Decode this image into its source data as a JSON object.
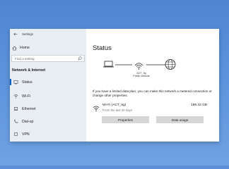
{
  "window": {
    "title": "Settings"
  },
  "sidebar": {
    "home_label": "Home",
    "search_placeholder": "Find a setting",
    "section_title": "Network & Internet",
    "items": [
      {
        "label": "Status",
        "icon": "globe-icon",
        "active": true
      },
      {
        "label": "Wi-Fi",
        "icon": "wifi-icon"
      },
      {
        "label": "Ethernet",
        "icon": "ethernet-icon"
      },
      {
        "label": "Dial-up",
        "icon": "phone-icon"
      },
      {
        "label": "VPN",
        "icon": "vpn-icon"
      }
    ]
  },
  "main": {
    "title": "Status",
    "network_name": "ACT_5g",
    "network_type": "Public network",
    "info_text": "If you have a limited data plan, you can make this network a metered connection or change other properties.",
    "connection": {
      "name": "Wi-Fi (ACT_5g)",
      "period": "From the last 30 days",
      "usage": "189.32 GB"
    },
    "properties_label": "Properties",
    "data_usage_label": "Data usage"
  },
  "colors": {
    "background": "#5a8fd6",
    "sidebar_bg": "#e9edf4",
    "accent": "#0b62c4",
    "button_bg": "#d6d6d6"
  }
}
